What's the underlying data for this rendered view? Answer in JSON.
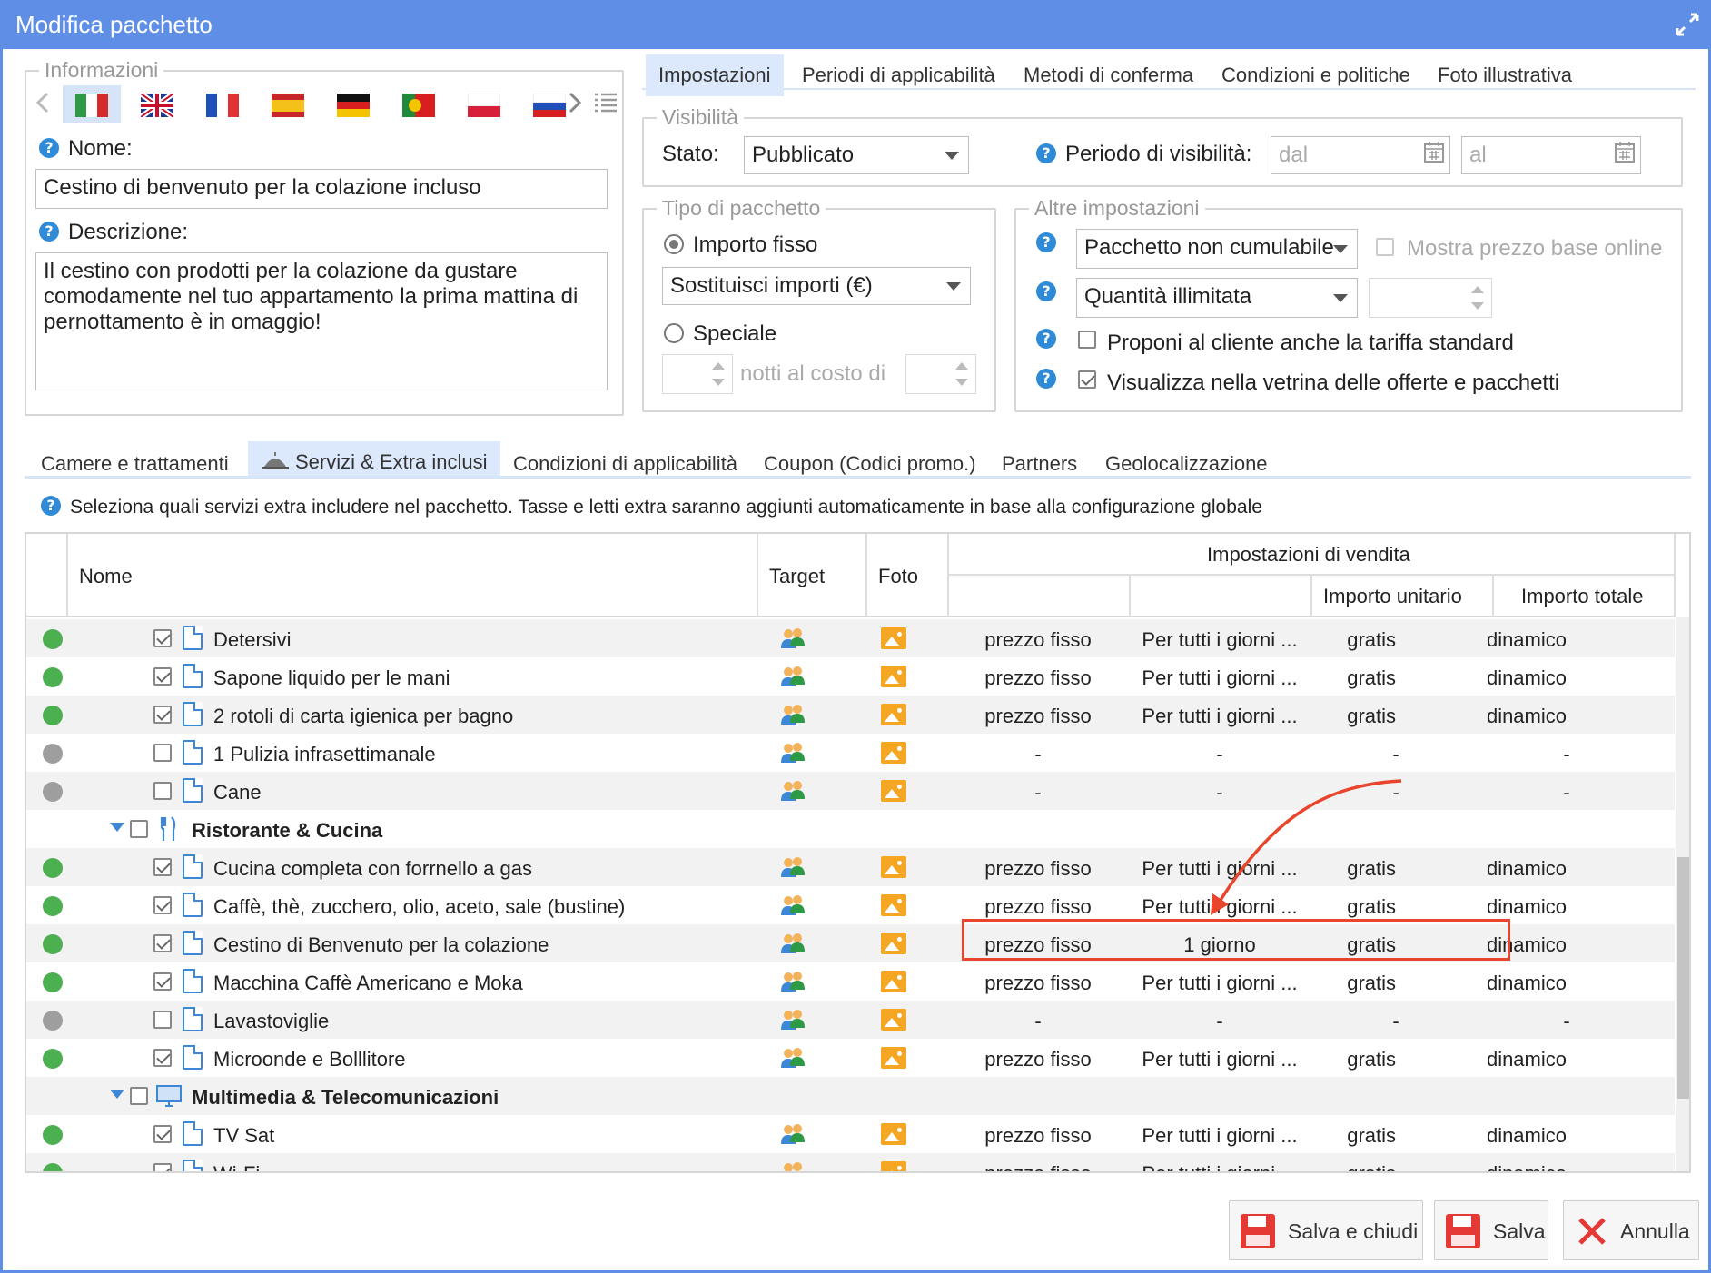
{
  "window": {
    "title": "Modifica pacchetto"
  },
  "info": {
    "legend": "Informazioni",
    "name_label": "Nome:",
    "name_value": "Cestino di benvenuto per la colazione incluso",
    "desc_label": "Descrizione:",
    "desc_value": "Il  cestino con prodotti per la colazione da gustare comodamente nel tuo appartamento la prima mattina di pernottamento è in omaggio!",
    "languages": [
      "it",
      "en",
      "fr",
      "es",
      "de",
      "pt",
      "pl",
      "ru"
    ]
  },
  "top_tabs": [
    "Impostazioni",
    "Periodi di applicabilità",
    "Metodi di conferma",
    "Condizioni e politiche",
    "Foto illustrativa"
  ],
  "visibility": {
    "legend": "Visibilità",
    "stato_label": "Stato:",
    "stato_value": "Pubblicato",
    "periodo_label": "Periodo di visibilità:",
    "dal_placeholder": "dal",
    "al_placeholder": "al"
  },
  "tipo": {
    "legend": "Tipo di pacchetto",
    "importo_fisso": "Importo fisso",
    "sostituisci": "Sostituisci importi (€)",
    "speciale": "Speciale",
    "notti": "notti al costo di"
  },
  "altre": {
    "legend": "Altre impostazioni",
    "cumulabile": "Pacchetto non cumulabile",
    "mostra_prezzo": "Mostra prezzo base online",
    "quantita": "Quantità illimitata",
    "proponi": "Proponi al cliente anche la tariffa standard",
    "visualizza": "Visualizza nella vetrina delle offerte e pacchetti"
  },
  "bottom_tabs": [
    "Camere e trattamenti",
    "Servizi & Extra inclusi",
    "Condizioni di applicabilità",
    "Coupon (Codici promo.)",
    "Partners",
    "Geolocalizzazione"
  ],
  "info_bar": "Seleziona quali servizi extra includere nel pacchetto. Tasse e letti extra saranno aggiunti automaticamente in base alla configurazione globale",
  "grid": {
    "headers": {
      "nome": "Nome",
      "target": "Target",
      "foto": "Foto",
      "vendita": "Impostazioni di vendita",
      "unitario": "Importo unitario",
      "totale": "Importo totale"
    },
    "rows": [
      {
        "kind": "item",
        "on": true,
        "name": "Detersivi",
        "c1": "prezzo fisso",
        "c2": "Per tutti i giorni ...",
        "c3": "gratis",
        "c4": "dinamico"
      },
      {
        "kind": "item",
        "on": true,
        "name": "Sapone liquido per le mani",
        "c1": "prezzo fisso",
        "c2": "Per tutti i giorni ...",
        "c3": "gratis",
        "c4": "dinamico"
      },
      {
        "kind": "item",
        "on": true,
        "name": "2 rotoli di carta igienica per bagno",
        "c1": "prezzo fisso",
        "c2": "Per tutti i giorni ...",
        "c3": "gratis",
        "c4": "dinamico"
      },
      {
        "kind": "item",
        "on": false,
        "name": "1 Pulizia infrasettimanale",
        "c1": "-",
        "c2": "-",
        "c3": "-",
        "c4": "-"
      },
      {
        "kind": "item",
        "on": false,
        "name": "Cane",
        "c1": "-",
        "c2": "-",
        "c3": "-",
        "c4": "-"
      },
      {
        "kind": "group",
        "name": "Ristorante & Cucina",
        "icon": "fork-knife-icon"
      },
      {
        "kind": "item",
        "on": true,
        "name": "Cucina completa con forrnello a gas",
        "c1": "prezzo fisso",
        "c2": "Per tutti i giorni ...",
        "c3": "gratis",
        "c4": "dinamico"
      },
      {
        "kind": "item",
        "on": true,
        "name": "Caffè, thè, zucchero, olio, aceto, sale (bustine)",
        "c1": "prezzo fisso",
        "c2": "Per tutti i giorni ...",
        "c3": "gratis",
        "c4": "dinamico"
      },
      {
        "kind": "item",
        "on": true,
        "name": "Cestino di Benvenuto per la colazione",
        "c1": "prezzo fisso",
        "c2": "1 giorno",
        "c3": "gratis",
        "c4": "dinamico",
        "highlight": true
      },
      {
        "kind": "item",
        "on": true,
        "name": "Macchina Caffè Americano e Moka",
        "c1": "prezzo fisso",
        "c2": "Per tutti i giorni ...",
        "c3": "gratis",
        "c4": "dinamico"
      },
      {
        "kind": "item",
        "on": false,
        "name": "Lavastoviglie",
        "c1": "-",
        "c2": "-",
        "c3": "-",
        "c4": "-"
      },
      {
        "kind": "item",
        "on": true,
        "name": "Microonde e Bolllitore",
        "c1": "prezzo fisso",
        "c2": "Per tutti i giorni ...",
        "c3": "gratis",
        "c4": "dinamico"
      },
      {
        "kind": "group",
        "name": "Multimedia & Telecomunicazioni",
        "icon": "monitor-icon"
      },
      {
        "kind": "item",
        "on": true,
        "name": "TV Sat",
        "c1": "prezzo fisso",
        "c2": "Per tutti i giorni ...",
        "c3": "gratis",
        "c4": "dinamico"
      },
      {
        "kind": "item",
        "on": true,
        "name": "Wi-Fi",
        "c1": "prezzo fisso",
        "c2": "Per tutti i giorni ...",
        "c3": "gratis",
        "c4": "dinamico"
      }
    ]
  },
  "buttons": {
    "save_close": "Salva e chiudi",
    "save": "Salva",
    "cancel": "Annulla"
  },
  "colors": {
    "accent": "#5f8ee6",
    "active_green": "#4caf50",
    "inactive_grey": "#9e9e9e",
    "highlight_red": "#e8452c"
  }
}
